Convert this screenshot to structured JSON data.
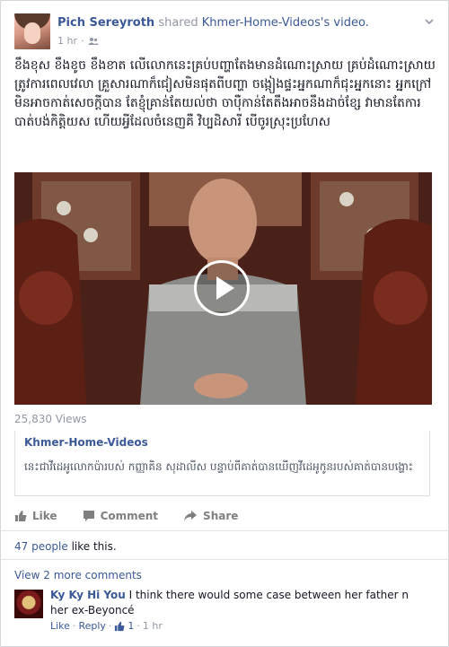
{
  "post": {
    "author": "Pich Sereyroth",
    "shared_text": "shared",
    "source": "Khmer-Home-Videos",
    "source_suffix": "'s video.",
    "time": "1 hr",
    "privacy_icon": "friends-icon",
    "text": "ខឹងខុស ខឹងខូច ខឹងខាត លើលោកនេះគ្រប់បញ្ហាតែងមានដំណោះស្រាយ គ្រប់ដំណោះស្រាយត្រូវការពេលវេលា គ្រួសារណាក៏ជៀសមិនផុតពីបញ្ហា ចង្កៀងផ្ទះអ្នកណាក៏ជុះអ្នកនោះ អ្នកក្រៅមិនអាចកាត់សេចក្តីបាន តែខ្ញុំគ្រាន់តែយល់ថា ចាប៉ឺកាន់តែតឹងអាចនឹងដាច់ខ្សែ វាមានតែការបាត់បង់កិត្តិយស ហើយអ្វីដែលចំនេញគឺ វិប្បដិសារី បើចូរស្រុះប្រហែស"
  },
  "video": {
    "views": "25,830 Views",
    "play_icon": "play-icon"
  },
  "attachment": {
    "title": "Khmer-Home-Videos",
    "description": "នេះជាវីដេអូលោកប៉ារបស់ កញ្ញាគិន សុដាលីស បន្ទាប់ពីគាត់បានឃើញវីដេអូកូនរបស់គាត់បានបង្ហោះ"
  },
  "actions": {
    "like": "Like",
    "comment": "Comment",
    "share": "Share"
  },
  "likes": {
    "count": "47 people",
    "rest": " like this."
  },
  "more_comments": "View 2 more comments",
  "comment": {
    "author": "Ky Ky Hi You",
    "text": " I think there would some case between her father n her ex-Beyoncé",
    "like": "Like",
    "sep": " · ",
    "reply": "Reply",
    "like_count": "1",
    "time": "1 hr"
  },
  "colors": {
    "link": "#3b5998",
    "muted": "#9197a3"
  }
}
